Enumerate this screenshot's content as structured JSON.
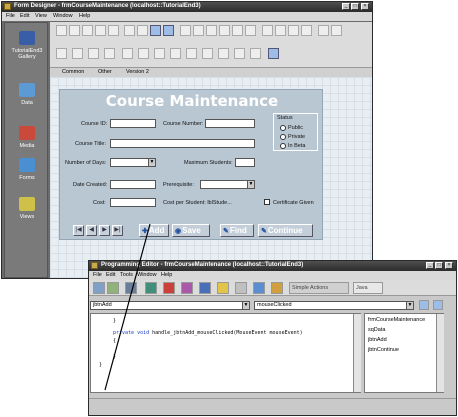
{
  "form_designer": {
    "title": "Form Designer - frmCourseMaintenance (localhost::TutorialEnd3)",
    "menu": [
      "File",
      "Edit",
      "View",
      "Window",
      "Help"
    ],
    "gallery": [
      {
        "icon": "gallery-icon",
        "label": "TutorialEnd3\nGallery"
      },
      {
        "icon": "data-icon",
        "label": "Data"
      },
      {
        "icon": "media-icon",
        "label": "Media"
      },
      {
        "icon": "forms-icon",
        "label": "Forms"
      },
      {
        "icon": "views-icon",
        "label": "Views"
      }
    ],
    "tabs": [
      "Common",
      "Other",
      "Version 2"
    ]
  },
  "course_form": {
    "title": "Course Maintenance",
    "course_id_label": "Course ID:",
    "course_number_label": "Course Number:",
    "course_title_label": "Course Title:",
    "number_of_days_label": "Number of Days:",
    "max_students_label": "Maximum Students:",
    "date_created_label": "Date Created:",
    "prerequisite_label": "Prerequisite:",
    "cost_label": "Cost:",
    "cost_per_student_label": "Cost per Student: lblStude...",
    "certificate_label": "Certificate Given",
    "status_label": "Status",
    "status_options": [
      "Public",
      "Private",
      "In Beta"
    ],
    "nav_buttons": [
      "|◀",
      "◀",
      "▶",
      "▶|"
    ],
    "add_label": "Add",
    "save_label": "Save",
    "find_label": "Find",
    "continue_label": "Continue"
  },
  "programming_editor": {
    "title": "Programming Editor - frmCourseMaintenance (localhost::TutorialEnd3)",
    "menu": [
      "File",
      "Edit",
      "Tools",
      "Window",
      "Help"
    ],
    "simple_actions_label": "Simple Actions",
    "java_label": "Java",
    "object_combo": "jbtnAdd",
    "event_combo": "mouseClicked",
    "code": {
      "line1": "}",
      "line2_kw": "private void",
      "line2_rest": " handle_jbtnAdd_mouseClicked(MouseEvent mouseEvent)",
      "line3": "{",
      "line4": "",
      "line5": "}",
      "line6": "}"
    },
    "members": [
      "frmCourseMaintenance",
      "sqData",
      "jbtnAdd",
      "jbtnContinue"
    ]
  },
  "colors": {
    "form_bg": "#b9c7d3",
    "window_bg": "#6b6b6b",
    "keyword": "#1a39c2"
  }
}
